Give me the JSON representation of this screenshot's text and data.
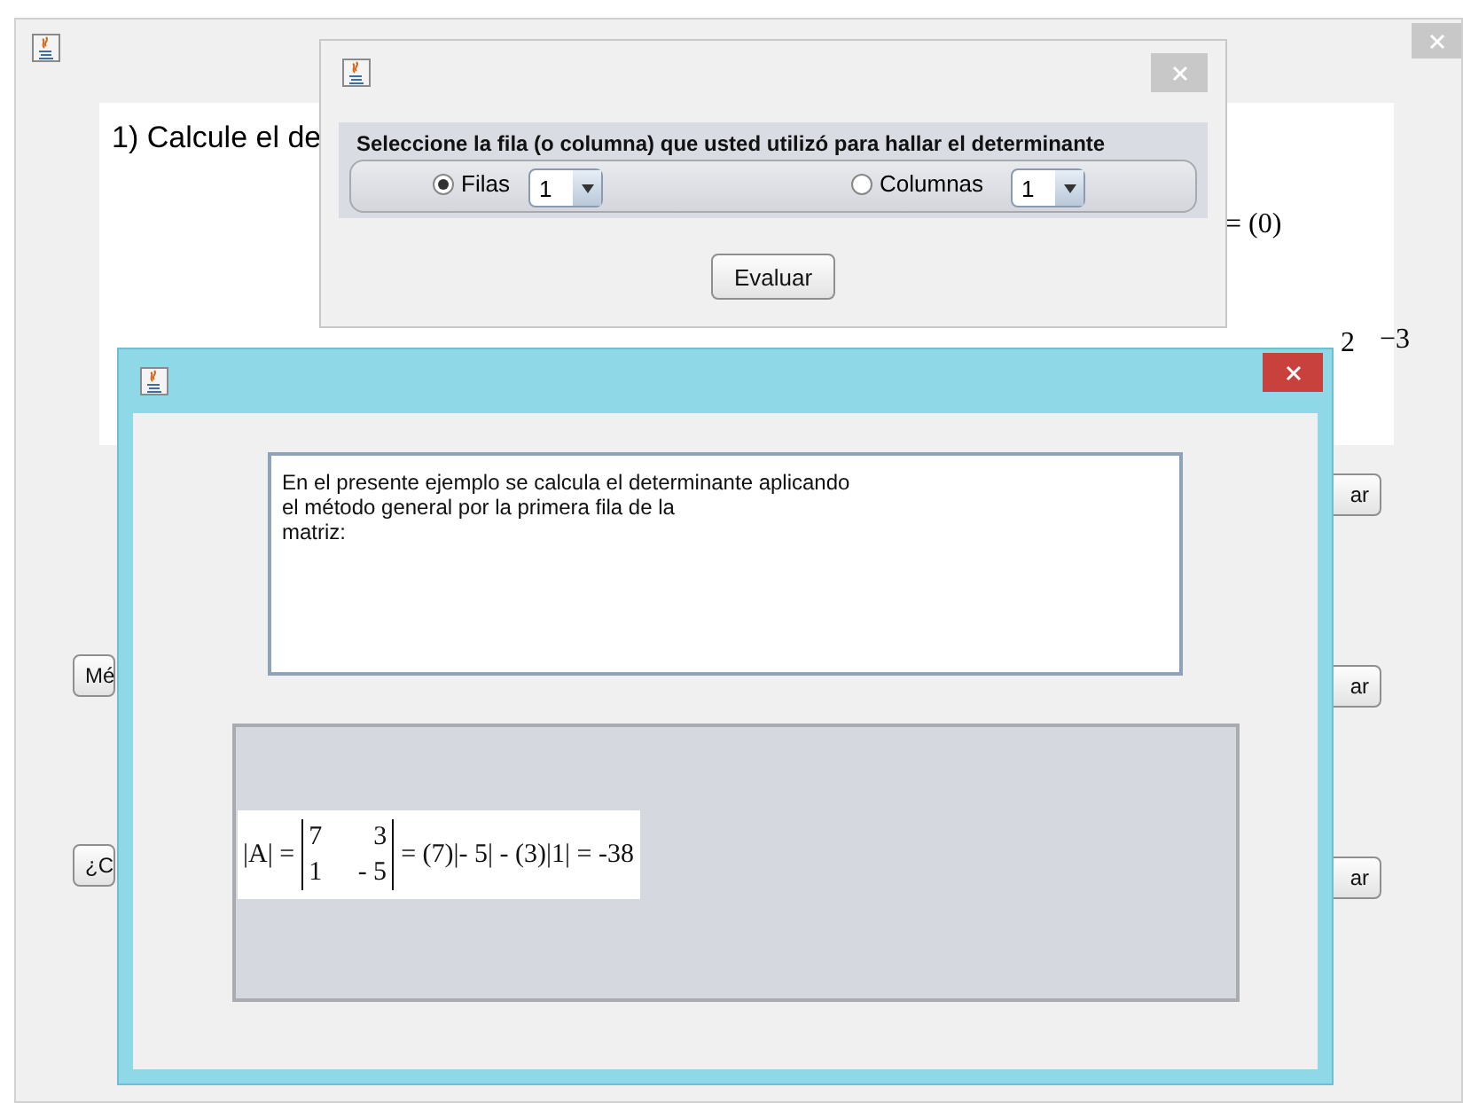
{
  "main_window": {
    "question": "1) Calcule el de",
    "result_fragment": "= (0)",
    "matrix_fragment": [
      "2",
      "−3"
    ],
    "left_buttons": [
      "Mé",
      "¿C"
    ],
    "right_buttons": [
      "ar",
      "ar",
      "ar"
    ]
  },
  "selection_dialog": {
    "instruction": "Seleccione la fila (o columna) que usted utilizó para hallar el determinante",
    "options": [
      {
        "label": "Filas",
        "selected": true,
        "value": "1"
      },
      {
        "label": "Columnas",
        "selected": false,
        "value": "1"
      }
    ],
    "button": "Evaluar"
  },
  "example_dialog": {
    "explanation": [
      "En el presente ejemplo se calcula el determinante aplicando",
      "el método general por la primera fila de la",
      "matriz:"
    ],
    "formula": {
      "lhs": "|A| =",
      "matrix": [
        [
          "7",
          "3"
        ],
        [
          "1",
          "- 5"
        ]
      ],
      "rhs": "= (7)|- 5| - (3)|1| = -38"
    }
  }
}
